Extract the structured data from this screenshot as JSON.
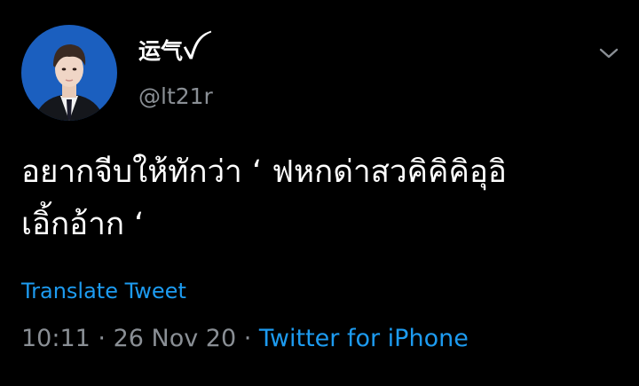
{
  "tweet": {
    "display_name": "运气ꪜ",
    "handle": "@lt21r",
    "text": "อยากจีบให้ทักว่า ‘ ฟหกด่าสวคิคิคิอุอิ\nเอิ้กอ้าก ‘",
    "translate_label": "Translate Tweet",
    "time": "10:11",
    "separator": " · ",
    "date": "26 Nov 20",
    "source": "Twitter for iPhone"
  },
  "icons": {
    "menu": "chevron-down-icon",
    "avatar": "profile-photo"
  },
  "colors": {
    "background": "#000000",
    "text": "#ffffff",
    "muted": "#8a8f95",
    "link": "#1d9bf0"
  }
}
